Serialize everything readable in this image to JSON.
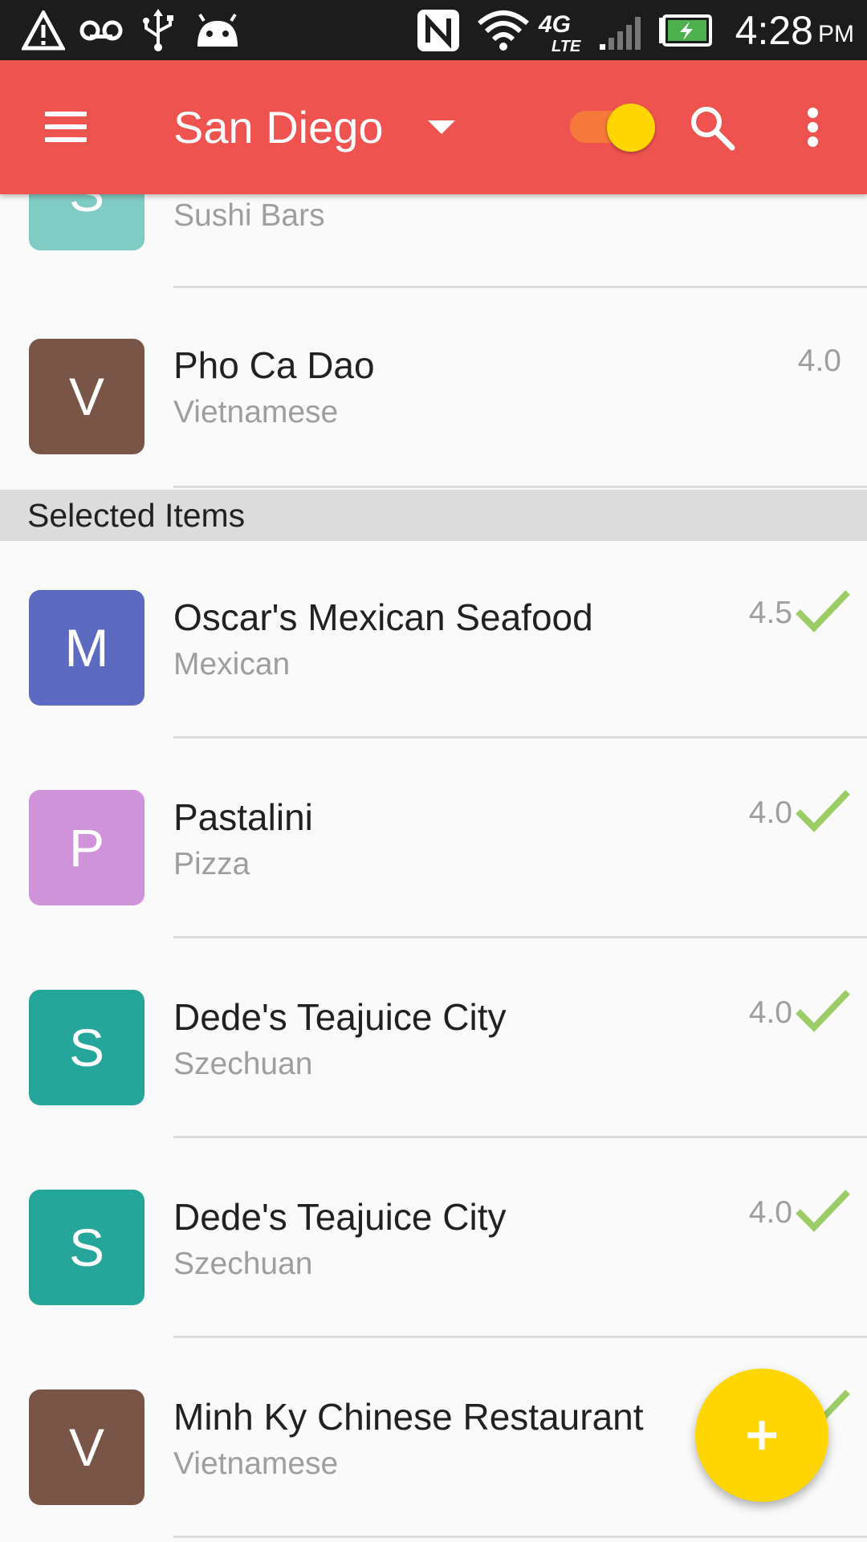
{
  "status_bar": {
    "time": "4:28",
    "ampm": "PM",
    "icons": [
      "alert-triangle-icon",
      "voicemail-icon",
      "usb-icon",
      "android-icon",
      "nfc-icon",
      "wifi-icon",
      "4g-lte-icon",
      "cell-signal-icon",
      "battery-charging-icon"
    ]
  },
  "toolbar": {
    "title": "San Diego",
    "icons": [
      "menu-icon",
      "dropdown-arrow-icon",
      "toggle-switch",
      "search-icon",
      "more-vert-icon"
    ],
    "switch_on": true,
    "accent_color": "#ef5350"
  },
  "list": {
    "partial_item": {
      "letter": "S",
      "subtitle": "Sushi Bars",
      "avatar_color": "#80cbc4"
    },
    "items_top": [
      {
        "letter": "V",
        "title": "Pho Ca Dao",
        "subtitle": "Vietnamese",
        "rating": "4.0",
        "avatar_color": "#795548",
        "selected": false
      }
    ],
    "section_header": "Selected Items",
    "selected_items": [
      {
        "letter": "M",
        "title": "Oscar's Mexican Seafood",
        "subtitle": "Mexican",
        "rating": "4.5",
        "avatar_color": "#5c6bc0",
        "selected": true
      },
      {
        "letter": "P",
        "title": "Pastalini",
        "subtitle": "Pizza",
        "rating": "4.0",
        "avatar_color": "#ce93d8",
        "selected": true
      },
      {
        "letter": "S",
        "title": "Dede's Teajuice City",
        "subtitle": "Szechuan",
        "rating": "4.0",
        "avatar_color": "#26a69a",
        "selected": true
      },
      {
        "letter": "S",
        "title": "Dede's Teajuice City",
        "subtitle": "Szechuan",
        "rating": "4.0",
        "avatar_color": "#26a69a",
        "selected": true
      },
      {
        "letter": "V",
        "title": "Minh Ky Chinese Restaurant",
        "subtitle": "Vietnamese",
        "rating": "",
        "avatar_color": "#795548",
        "selected": true
      }
    ],
    "check_color": "#9ccc65"
  },
  "fab": {
    "label": "+",
    "icon": "add-icon",
    "color": "#ffd600"
  }
}
